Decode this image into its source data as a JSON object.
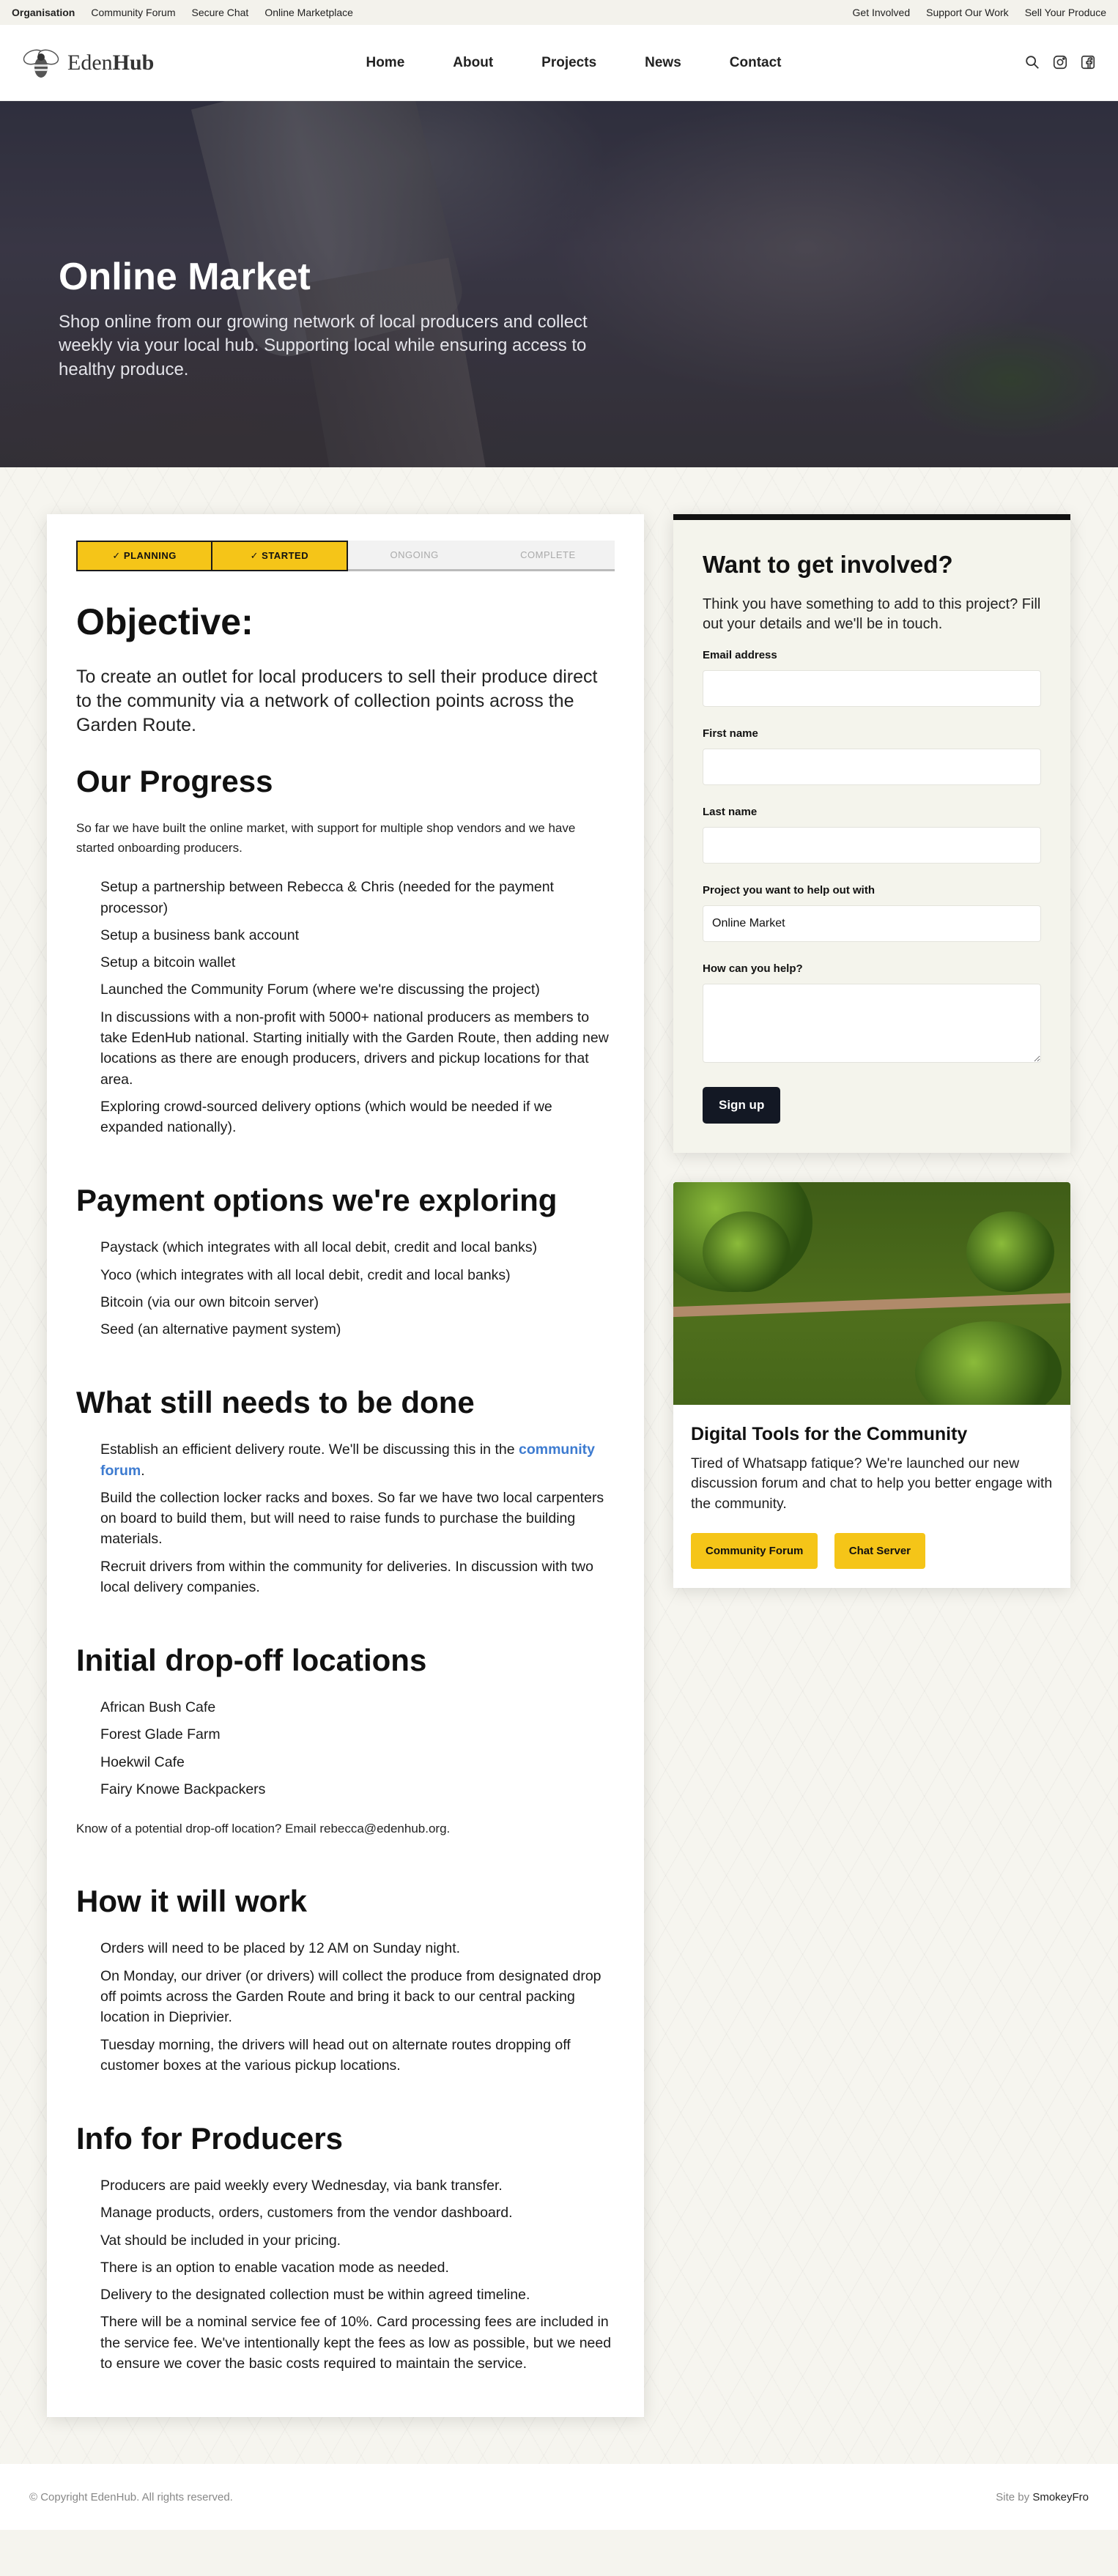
{
  "topbar": {
    "left": [
      "Organisation",
      "Community Forum",
      "Secure Chat",
      "Online Marketplace"
    ],
    "right": [
      "Get Involved",
      "Support Our Work",
      "Sell Your Produce"
    ]
  },
  "header": {
    "brand_light": "Eden",
    "brand_bold": "Hub",
    "nav": [
      "Home",
      "About",
      "Projects",
      "News",
      "Contact"
    ],
    "icons": [
      "search-icon",
      "instagram-icon",
      "facebook-icon"
    ]
  },
  "hero": {
    "title": "Online Market",
    "subtitle": "Shop online from our growing network of local producers and collect weekly via your local hub. Supporting local while ensuring access to healthy produce."
  },
  "progress": {
    "steps": [
      {
        "label": "✓ PLANNING",
        "done": true
      },
      {
        "label": "✓ STARTED",
        "done": true
      },
      {
        "label": "ONGOING",
        "done": false
      },
      {
        "label": "COMPLETE",
        "done": false
      }
    ]
  },
  "main": {
    "objective_title": "Objective:",
    "objective_text": "To create an outlet for local producers to sell their produce direct to the community via a network of collection points across the Garden Route.",
    "progress_title": "Our Progress",
    "progress_intro": "So far we have built the online market, with support for multiple shop vendors and we have started onboarding producers.",
    "progress_items": [
      "Setup a partnership between Rebecca & Chris (needed for the payment processor)",
      "Setup a business bank account",
      "Setup a bitcoin wallet",
      "Launched the Community Forum (where we're discussing the project)",
      "In discussions with a non-profit with 5000+ national producers as members to take EdenHub national. Starting initially with the Garden Route, then adding new locations as there are enough producers, drivers and pickup locations for that area.",
      "Exploring crowd-sourced delivery options (which would be needed if we expanded nationally)."
    ],
    "payment_title": "Payment options we're exploring",
    "payment_items": [
      "Paystack (which integrates with all local debit, credit and local banks)",
      "Yoco (which integrates with all local debit, credit and local banks)",
      "Bitcoin (via our own bitcoin server)",
      "Seed (an alternative payment system)"
    ],
    "todo_title": "What still needs to be done",
    "todo_first_text": "Establish an efficient delivery route. We'll be discussing this in the ",
    "todo_first_link": "community forum",
    "todo_first_end": ".",
    "todo_items": [
      "Build the collection locker racks and boxes. So far we have two local carpenters on board to build them, but will need to raise funds to purchase the building materials.",
      "Recruit drivers from within the community for deliveries. In discussion with two local delivery companies."
    ],
    "dropoff_title": "Initial drop-off locations",
    "dropoff_items": [
      "African Bush Cafe",
      "Forest Glade Farm",
      "Hoekwil Cafe",
      "Fairy Knowe Backpackers"
    ],
    "dropoff_note": "Know of a potential drop-off location? Email rebecca@edenhub.org.",
    "how_title": "How it will work",
    "how_items": [
      "Orders will need to be placed by 12 AM on Sunday night.",
      "On Monday, our driver (or drivers) will collect the produce from designated drop off poimts across the Garden Route and bring it back to our central packing location in Dieprivier.",
      "Tuesday morning, the drivers will head out on alternate routes dropping off customer boxes at the various pickup locations."
    ],
    "producers_title": "Info for Producers",
    "producers_items": [
      "Producers are paid weekly every Wednesday, via bank transfer.",
      "Manage products, orders, customers from the vendor dashboard.",
      "Vat should be included in your pricing.",
      "There is an option to enable vacation mode as needed.",
      "Delivery to the designated collection must be within agreed timeline.",
      "There will be a nominal service fee of 10%. Card processing fees are included in the service fee. We've intentionally kept the fees as low as possible, but we need to ensure we cover the basic costs required to maintain the service."
    ]
  },
  "form": {
    "title": "Want to get involved?",
    "intro": "Think you have something to add to this project? Fill out your details and we'll be in touch.",
    "email_label": "Email address",
    "first_label": "First name",
    "last_label": "Last name",
    "project_label": "Project you want to help out with",
    "project_value": "Online Market",
    "help_label": "How can you help?",
    "submit": "Sign up"
  },
  "tools": {
    "title": "Digital Tools for the Community",
    "text": "Tired of Whatsapp fatique? We're launched our new discussion forum and chat to help you better engage with the community.",
    "btn_forum": "Community Forum",
    "btn_chat": "Chat Server"
  },
  "footer": {
    "copyright": "© Copyright EdenHub. All rights reserved.",
    "credit_prefix": "Site by ",
    "credit_name": "SmokeyFro"
  },
  "colors": {
    "accent_yellow": "#f5c518",
    "dark_button": "#131824",
    "link_blue": "#3d7bd0"
  }
}
